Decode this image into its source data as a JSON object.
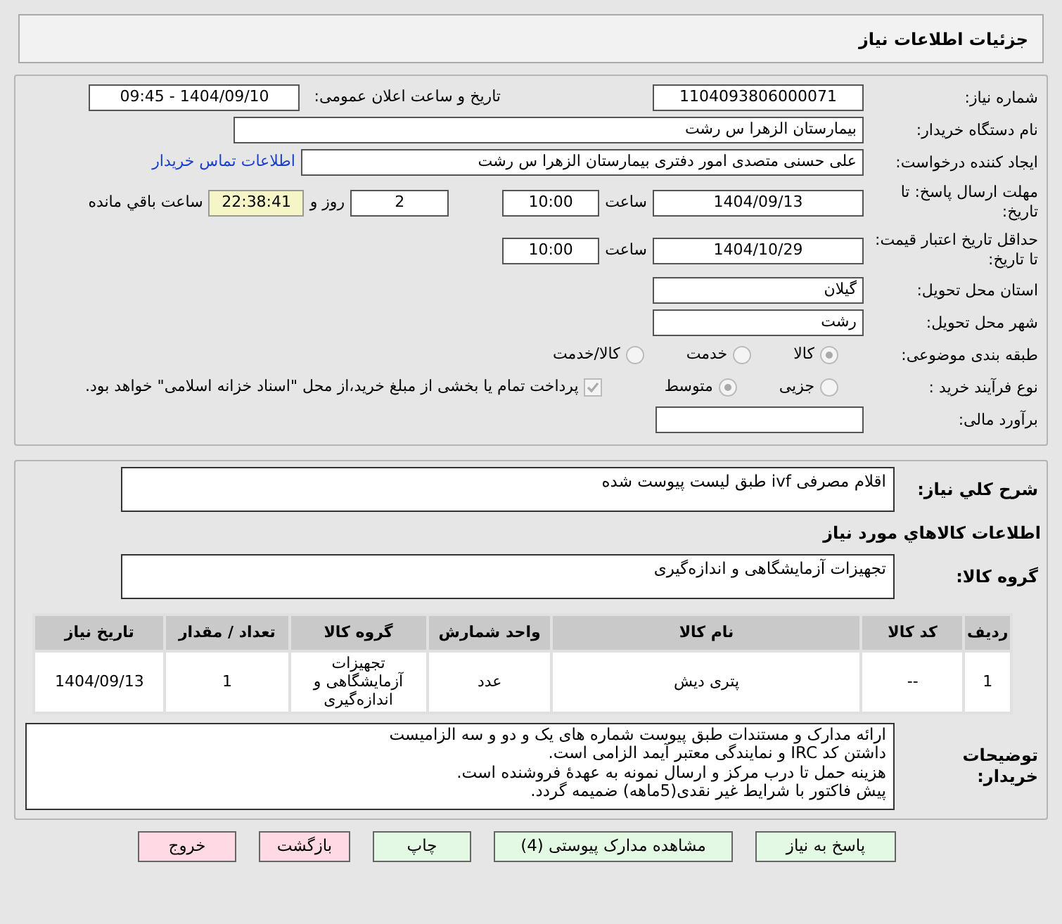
{
  "title": "جزئیات اطلاعات نیاز",
  "need_number": {
    "label": "شماره نیاز:",
    "value": "1104093806000071"
  },
  "announce": {
    "label": "تاریخ و ساعت اعلان عمومی:",
    "value": "1404/09/10 - 09:45"
  },
  "buyer": {
    "label": "نام دستگاه خریدار:",
    "value": "بیمارستان الزهرا  س  رشت"
  },
  "requester": {
    "label": "ایجاد کننده درخواست:",
    "value": "علی حسنی متصدی امور دفتری بیمارستان الزهرا  س  رشت",
    "link": "اطلاعات تماس خریدار"
  },
  "deadline": {
    "label": "مهلت ارسال پاسخ: تا تاریخ:",
    "date": "1404/09/13",
    "time_label": "ساعت",
    "time": "10:00",
    "days": "2",
    "days_label": "روز و",
    "remaining": "22:38:41",
    "remaining_label": "ساعت باقي مانده"
  },
  "validity": {
    "label": "حداقل تاریخ اعتبار قیمت: تا تاریخ:",
    "date": "1404/10/29",
    "time_label": "ساعت",
    "time": "10:00"
  },
  "province": {
    "label": "استان محل تحویل:",
    "value": "گیلان"
  },
  "city": {
    "label": "شهر محل تحویل:",
    "value": "رشت"
  },
  "category": {
    "label": "طبقه بندی موضوعی:",
    "options": [
      {
        "label": "کالا",
        "selected": true
      },
      {
        "label": "خدمت",
        "selected": false
      },
      {
        "label": "کالا/خدمت",
        "selected": false
      }
    ]
  },
  "process": {
    "label": "نوع فرآیند خرید :",
    "options": [
      {
        "label": "جزیی",
        "selected": false
      },
      {
        "label": "متوسط",
        "selected": true
      }
    ],
    "payment": {
      "checked": true,
      "text": "پرداخت تمام یا بخشی از مبلغ خرید،از محل \"اسناد خزانه اسلامی\" خواهد بود."
    }
  },
  "budget": {
    "label": "برآورد مالی:"
  },
  "description": {
    "label": "شرح کلي نیاز:",
    "value": "اقلام مصرفی ivf طبق لیست پیوست شده"
  },
  "goods_heading": "اطلاعات کالاهاي مورد نیاز",
  "goods_group": {
    "label": "گروه کالا:",
    "value": "تجهیزات آزمایشگاهی و اندازه‌گیری"
  },
  "table": {
    "columns": [
      "ردیف",
      "کد کالا",
      "نام کالا",
      "واحد شمارش",
      "گروه کالا",
      "تعداد / مقدار",
      "تاریخ نیاز"
    ],
    "rows": [
      [
        "1",
        "--",
        "پتری دیش",
        "عدد",
        "تجهیزات آزمایشگاهی و اندازه‌گیری",
        "1",
        "1404/09/13"
      ]
    ]
  },
  "notes": {
    "label": "توضیحات خریدار:",
    "lines": [
      "ارائه مدارک و مستندات طبق پیوست شماره های یک و دو و سه الزامیست",
      "داشتن کد IRC و نمایندگی معتبر آیمد الزامی است.",
      "هزینه حمل تا درب مرکز و ارسال نمونه به عهدهٔ فروشنده است.",
      "پیش فاکتور با شرایط غیر نقدی(5ماهه) ضمیمه گردد."
    ]
  },
  "buttons": [
    {
      "label": "پاسخ به نیاز",
      "kind": "action"
    },
    {
      "label": "مشاهده مدارک پیوستی (4)",
      "kind": "action"
    },
    {
      "label": "چاپ",
      "kind": "action"
    },
    {
      "label": "بازگشت",
      "kind": "exit"
    },
    {
      "label": "خروج",
      "kind": "exit"
    }
  ]
}
